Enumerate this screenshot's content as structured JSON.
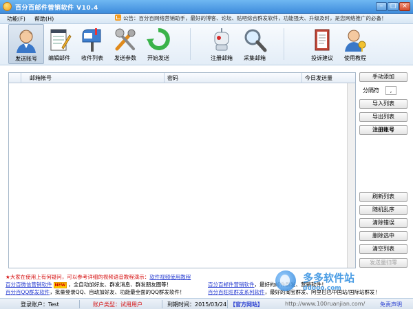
{
  "window": {
    "title": "百分百邮件营销软件   V10.4",
    "buttons": [
      "–",
      "□",
      "×"
    ]
  },
  "menu": {
    "items": [
      "功能(F)",
      "帮助(H)"
    ],
    "notice": "公告：百分百网络营销助手，最好的博客、论坛、贴吧综合群发软件，功能强大、升级及时，是您网络推广的必备！"
  },
  "toolbar": {
    "items": [
      {
        "label": "发送账号",
        "icon": "person-icon"
      },
      {
        "label": "编辑邮件",
        "icon": "notepad-icon"
      },
      {
        "label": "收件列表",
        "icon": "mailbox-icon"
      },
      {
        "label": "发送参数",
        "icon": "tools-icon"
      },
      {
        "label": "开始发送",
        "icon": "refresh-icon"
      },
      {
        "label": "注册邮箱",
        "icon": "robot-icon"
      },
      {
        "label": "采集邮箱",
        "icon": "magnifier-icon"
      },
      {
        "label": "投诉建议",
        "icon": "book-icon"
      },
      {
        "label": "使用教程",
        "icon": "key-user-icon"
      }
    ]
  },
  "table": {
    "columns": [
      "邮箱帐号",
      "密码",
      "今日发送量"
    ],
    "rows": []
  },
  "side": {
    "manual_add": "手动添加",
    "separator_label": "分隔符",
    "separator_value": ",",
    "import": "导入列表",
    "export": "导出列表",
    "register": "注册账号",
    "refresh": "刷新列表",
    "shuffle": "随机乱序",
    "clear_errors": "清除错误",
    "delete_selected": "删除选中",
    "clear_list": "清空列表",
    "send_count_reset": "发送量归零"
  },
  "info": {
    "line1_red": "★大家在使用上有何疑问，可以参考详细的视频语音教程演示：",
    "line1_link": "软件视频使用教程",
    "line2_link": "百分百微信营销软件",
    "line2_new": "NEW",
    "line2_text": "，全自动加好友、群发消息、群发朋友圈等！",
    "line2_link2": "百分百邮件营销软件",
    "line2_text2": "，最好的邮件群发、营销软件！",
    "line3_link": "百分百QQ群发软件",
    "line3_text": "，批量登录QQ、自动加好友、功能最全面的QQ群发软件！",
    "line3_link2": "百分百旺旺群发系列软件",
    "line3_text2": "，最好的淘宝群发、阿里巴巴中国站/国际站群发！"
  },
  "status": {
    "account": "登录账户：Test",
    "type": "账户类型：试用用户",
    "expire": "到期时间：2015/03/24",
    "site": "【官方网站】",
    "url": "http://www.100ruanjian.com/",
    "disclaimer": "免责声明"
  },
  "watermark": {
    "title": "多多软件站",
    "url": "ddooo.com"
  }
}
